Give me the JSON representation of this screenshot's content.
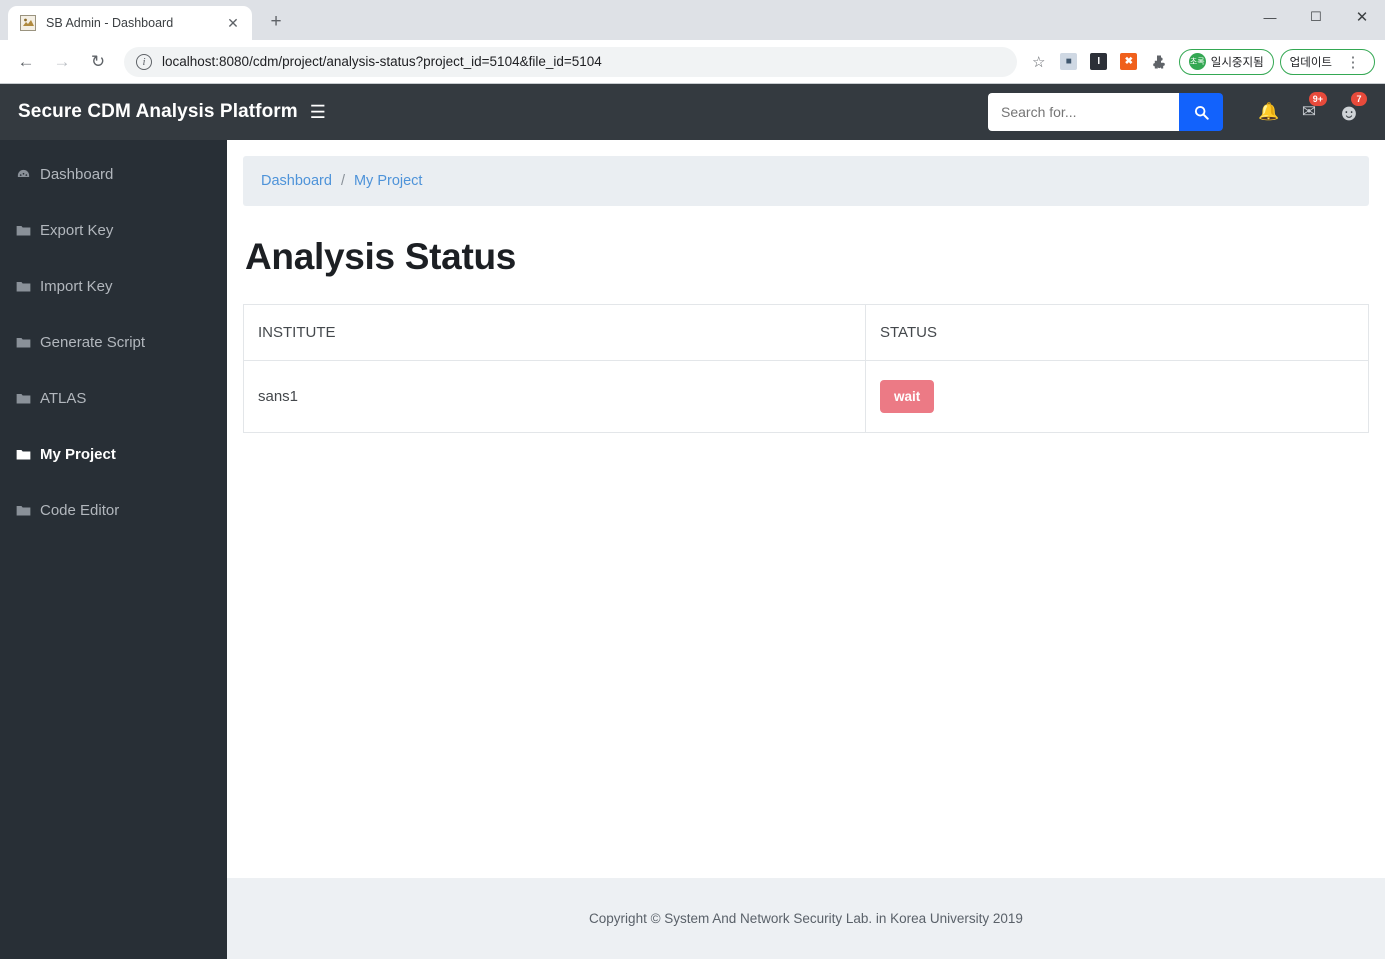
{
  "browser": {
    "tab": {
      "title": "SB Admin - Dashboard",
      "favicon_icon": "site-favicon",
      "close_icon": "close-icon",
      "new_tab_icon": "plus-icon"
    },
    "window_controls": {
      "minimize": "—",
      "maximize": "☐",
      "close": "✕"
    },
    "toolbar": {
      "back_icon": "←",
      "forward_icon": "→",
      "reload_icon": "↻",
      "site_info_icon": "i",
      "url": "localhost:8080/cdm/project/analysis-status?project_id=5104&file_id=5104",
      "bookmark_icon": "☆",
      "extension_icons": [
        "image-extension",
        "reader-extension",
        "blocker-extension",
        "puzzle-extension"
      ],
      "blocker_label": "✖",
      "reader_label": "I",
      "pause_pill": {
        "badge": "초록",
        "label": "일시중지됨"
      },
      "update_pill": {
        "label": "업데이트"
      },
      "kebab_icon": "⋮"
    }
  },
  "topnav": {
    "brand": "Secure CDM Analysis Platform",
    "sidebar_toggle_icon": "hamburger-icon",
    "search": {
      "placeholder": "Search for...",
      "value": "",
      "button_icon": "search-icon"
    },
    "icons": {
      "bell": "bell-icon",
      "envelope": "envelope-icon",
      "avatar": "user-avatar-icon"
    },
    "badges": {
      "messages": "9+",
      "alerts": "7"
    }
  },
  "sidebar": {
    "items": [
      {
        "label": "Dashboard",
        "icon": "tachometer-icon",
        "active": false
      },
      {
        "label": "Export Key",
        "icon": "folder-icon",
        "active": false
      },
      {
        "label": "Import Key",
        "icon": "folder-icon",
        "active": false
      },
      {
        "label": "Generate Script",
        "icon": "folder-icon",
        "active": false
      },
      {
        "label": "ATLAS",
        "icon": "folder-icon",
        "active": false
      },
      {
        "label": "My Project",
        "icon": "folder-open-icon",
        "active": true
      },
      {
        "label": "Code Editor",
        "icon": "folder-icon",
        "active": false
      }
    ]
  },
  "main": {
    "breadcrumb": {
      "items": [
        "Dashboard",
        "My Project"
      ],
      "separator": "/"
    },
    "page_title": "Analysis Status",
    "table": {
      "columns": [
        "INSTITUTE",
        "STATUS"
      ],
      "rows": [
        {
          "institute": "sans1",
          "status": "wait"
        }
      ]
    }
  },
  "footer": {
    "text": "Copyright © System And Network Security Lab. in Korea University 2019"
  },
  "colors": {
    "navbar": "#343a40",
    "sidebar": "#282f36",
    "accent_blue": "#1262fc",
    "link_blue": "#4e93d9",
    "status_wait": "#ec7a85",
    "badge_red": "#e74a3b",
    "breadcrumb_bg": "#eaeef2",
    "footer_bg": "#edf0f3"
  }
}
